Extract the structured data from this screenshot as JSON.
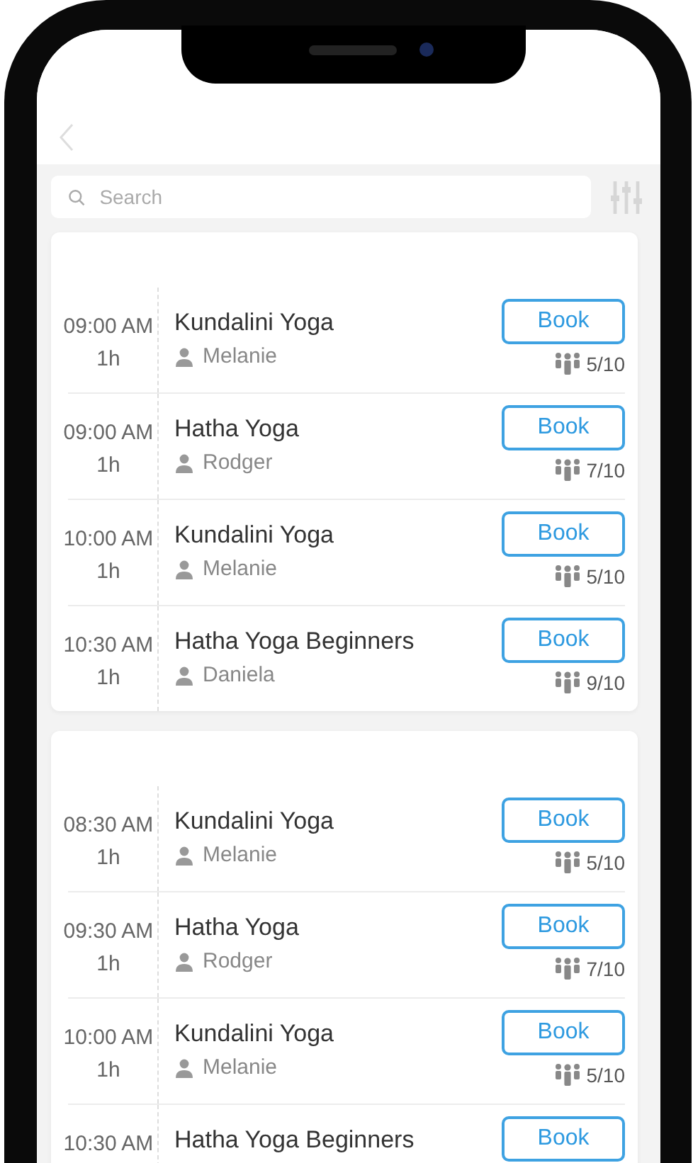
{
  "search": {
    "placeholder": "Search"
  },
  "sections": [
    {
      "classes": [
        {
          "time": "09:00 AM",
          "duration": "1h",
          "name": "Kundalini Yoga",
          "instructor": "Melanie",
          "action": "Book",
          "spots": "5/10"
        },
        {
          "time": "09:00 AM",
          "duration": "1h",
          "name": "Hatha Yoga",
          "instructor": "Rodger",
          "action": "Book",
          "spots": "7/10"
        },
        {
          "time": "10:00 AM",
          "duration": "1h",
          "name": "Kundalini Yoga",
          "instructor": "Melanie",
          "action": "Book",
          "spots": "5/10"
        },
        {
          "time": "10:30 AM",
          "duration": "1h",
          "name": "Hatha Yoga Beginners",
          "instructor": "Daniela",
          "action": "Book",
          "spots": "9/10"
        }
      ]
    },
    {
      "classes": [
        {
          "time": "08:30 AM",
          "duration": "1h",
          "name": "Kundalini Yoga",
          "instructor": "Melanie",
          "action": "Book",
          "spots": "5/10"
        },
        {
          "time": "09:30 AM",
          "duration": "1h",
          "name": "Hatha Yoga",
          "instructor": "Rodger",
          "action": "Book",
          "spots": "7/10"
        },
        {
          "time": "10:00 AM",
          "duration": "1h",
          "name": "Kundalini Yoga",
          "instructor": "Melanie",
          "action": "Book",
          "spots": "5/10"
        },
        {
          "time": "10:30 AM",
          "name": "Hatha Yoga Beginners",
          "action": "Book"
        }
      ]
    }
  ]
}
